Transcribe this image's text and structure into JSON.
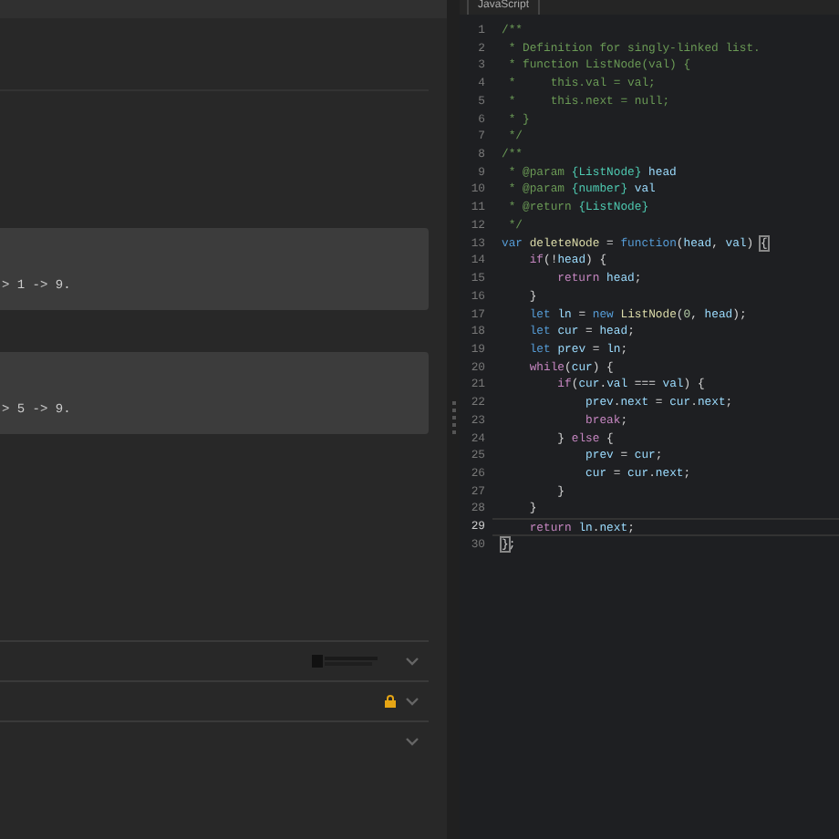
{
  "problem": {
    "examples": [
      {
        "text": "> 1 -> 9."
      },
      {
        "text": "> 5 -> 9."
      }
    ],
    "sections": [
      {
        "badge": true,
        "locked": false
      },
      {
        "badge": false,
        "locked": true
      },
      {
        "badge": false,
        "locked": false
      }
    ]
  },
  "editor": {
    "language": "JavaScript",
    "lines": [
      {
        "num": "1",
        "active": false,
        "tokens": [
          {
            "t": "/**",
            "kind": "comment"
          }
        ]
      },
      {
        "num": "2",
        "active": false,
        "tokens": [
          {
            "t": " * Definition for singly-linked list.",
            "kind": "comment"
          }
        ]
      },
      {
        "num": "3",
        "active": false,
        "tokens": [
          {
            "t": " * function ListNode(val) {",
            "kind": "comment"
          }
        ]
      },
      {
        "num": "4",
        "active": false,
        "tokens": [
          {
            "t": " *     this.val = val;",
            "kind": "comment"
          }
        ]
      },
      {
        "num": "5",
        "active": false,
        "tokens": [
          {
            "t": " *     this.next = null;",
            "kind": "comment"
          }
        ]
      },
      {
        "num": "6",
        "active": false,
        "tokens": [
          {
            "t": " * }",
            "kind": "comment"
          }
        ]
      },
      {
        "num": "7",
        "active": false,
        "tokens": [
          {
            "t": " */",
            "kind": "comment"
          }
        ]
      },
      {
        "num": "8",
        "active": false,
        "tokens": [
          {
            "t": "/**",
            "kind": "comment"
          }
        ]
      },
      {
        "num": "9",
        "active": false,
        "tokens": [
          {
            "t": " * @param ",
            "kind": "comment"
          },
          {
            "t": "{ListNode}",
            "kind": "type"
          },
          {
            "t": " head",
            "kind": "var"
          }
        ]
      },
      {
        "num": "10",
        "active": false,
        "tokens": [
          {
            "t": " * @param ",
            "kind": "comment"
          },
          {
            "t": "{number}",
            "kind": "type"
          },
          {
            "t": " val",
            "kind": "var"
          }
        ]
      },
      {
        "num": "11",
        "active": false,
        "tokens": [
          {
            "t": " * @return ",
            "kind": "comment"
          },
          {
            "t": "{ListNode}",
            "kind": "type"
          }
        ]
      },
      {
        "num": "12",
        "active": false,
        "tokens": [
          {
            "t": " */",
            "kind": "comment"
          }
        ]
      },
      {
        "num": "13",
        "active": false,
        "tokens": [
          {
            "t": "var",
            "kind": "kw"
          },
          {
            "t": " deleteNode",
            "kind": "fn"
          },
          {
            "t": " = "
          },
          {
            "t": "function",
            "kind": "kw"
          },
          {
            "t": "("
          },
          {
            "t": "head",
            "kind": "var"
          },
          {
            "t": ", "
          },
          {
            "t": "val",
            "kind": "var"
          },
          {
            "t": ") "
          },
          {
            "t": "{",
            "kind": "match"
          }
        ]
      },
      {
        "num": "14",
        "active": false,
        "tokens": [
          {
            "t": "    if",
            "kind": "ctrl"
          },
          {
            "t": "(!"
          },
          {
            "t": "head",
            "kind": "var"
          },
          {
            "t": ") {"
          }
        ]
      },
      {
        "num": "15",
        "active": false,
        "tokens": [
          {
            "t": "        return",
            "kind": "ctrl"
          },
          {
            "t": " head",
            "kind": "var"
          },
          {
            "t": ";"
          }
        ]
      },
      {
        "num": "16",
        "active": false,
        "tokens": [
          {
            "t": "    }"
          }
        ]
      },
      {
        "num": "17",
        "active": false,
        "tokens": [
          {
            "t": "    let",
            "kind": "kw"
          },
          {
            "t": " ln",
            "kind": "var"
          },
          {
            "t": " = "
          },
          {
            "t": "new",
            "kind": "kw"
          },
          {
            "t": " ListNode",
            "kind": "fn"
          },
          {
            "t": "("
          },
          {
            "t": "0",
            "kind": "num"
          },
          {
            "t": ", "
          },
          {
            "t": "head",
            "kind": "var"
          },
          {
            "t": ");"
          }
        ]
      },
      {
        "num": "18",
        "active": false,
        "tokens": [
          {
            "t": "    let",
            "kind": "kw"
          },
          {
            "t": " cur",
            "kind": "var"
          },
          {
            "t": " = "
          },
          {
            "t": "head",
            "kind": "var"
          },
          {
            "t": ";"
          }
        ]
      },
      {
        "num": "19",
        "active": false,
        "tokens": [
          {
            "t": "    let",
            "kind": "kw"
          },
          {
            "t": " prev",
            "kind": "var"
          },
          {
            "t": " = "
          },
          {
            "t": "ln",
            "kind": "var"
          },
          {
            "t": ";"
          }
        ]
      },
      {
        "num": "20",
        "active": false,
        "tokens": [
          {
            "t": "    while",
            "kind": "ctrl"
          },
          {
            "t": "("
          },
          {
            "t": "cur",
            "kind": "var"
          },
          {
            "t": ") {"
          }
        ]
      },
      {
        "num": "21",
        "active": false,
        "tokens": [
          {
            "t": "        if",
            "kind": "ctrl"
          },
          {
            "t": "("
          },
          {
            "t": "cur",
            "kind": "var"
          },
          {
            "t": "."
          },
          {
            "t": "val",
            "kind": "var"
          },
          {
            "t": " === "
          },
          {
            "t": "val",
            "kind": "var"
          },
          {
            "t": ") {"
          }
        ]
      },
      {
        "num": "22",
        "active": false,
        "tokens": [
          {
            "t": "            prev",
            "kind": "var"
          },
          {
            "t": "."
          },
          {
            "t": "next",
            "kind": "var"
          },
          {
            "t": " = "
          },
          {
            "t": "cur",
            "kind": "var"
          },
          {
            "t": "."
          },
          {
            "t": "next",
            "kind": "var"
          },
          {
            "t": ";"
          }
        ]
      },
      {
        "num": "23",
        "active": false,
        "tokens": [
          {
            "t": "            break",
            "kind": "ctrl"
          },
          {
            "t": ";"
          }
        ]
      },
      {
        "num": "24",
        "active": false,
        "tokens": [
          {
            "t": "        } "
          },
          {
            "t": "else",
            "kind": "ctrl"
          },
          {
            "t": " {"
          }
        ]
      },
      {
        "num": "25",
        "active": false,
        "tokens": [
          {
            "t": "            prev",
            "kind": "var"
          },
          {
            "t": " = "
          },
          {
            "t": "cur",
            "kind": "var"
          },
          {
            "t": ";"
          }
        ]
      },
      {
        "num": "26",
        "active": false,
        "tokens": [
          {
            "t": "            cur",
            "kind": "var"
          },
          {
            "t": " = "
          },
          {
            "t": "cur",
            "kind": "var"
          },
          {
            "t": "."
          },
          {
            "t": "next",
            "kind": "var"
          },
          {
            "t": ";"
          }
        ]
      },
      {
        "num": "27",
        "active": false,
        "tokens": [
          {
            "t": "        }"
          }
        ]
      },
      {
        "num": "28",
        "active": false,
        "tokens": [
          {
            "t": "    }"
          }
        ]
      },
      {
        "num": "29",
        "active": true,
        "tokens": [
          {
            "t": "    return",
            "kind": "ctrl"
          },
          {
            "t": " ln",
            "kind": "var"
          },
          {
            "t": "."
          },
          {
            "t": "next",
            "kind": "var"
          },
          {
            "t": ";"
          }
        ]
      },
      {
        "num": "30",
        "active": false,
        "tokens": [
          {
            "t": "}",
            "kind": "match"
          },
          {
            "t": ";"
          }
        ]
      }
    ]
  }
}
